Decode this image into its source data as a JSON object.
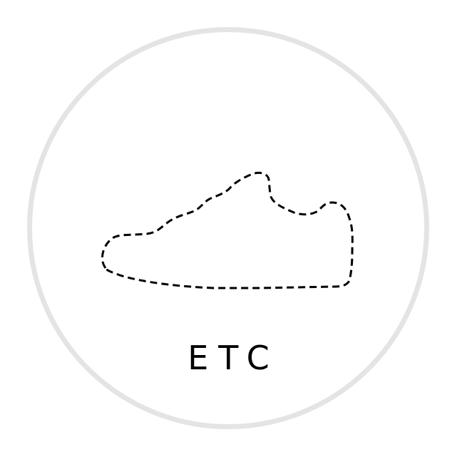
{
  "badge": {
    "icon": "sneaker-outline-dashed-icon",
    "label": "ETC",
    "ring_color": "#e4e4e4",
    "text_color": "#000000"
  }
}
